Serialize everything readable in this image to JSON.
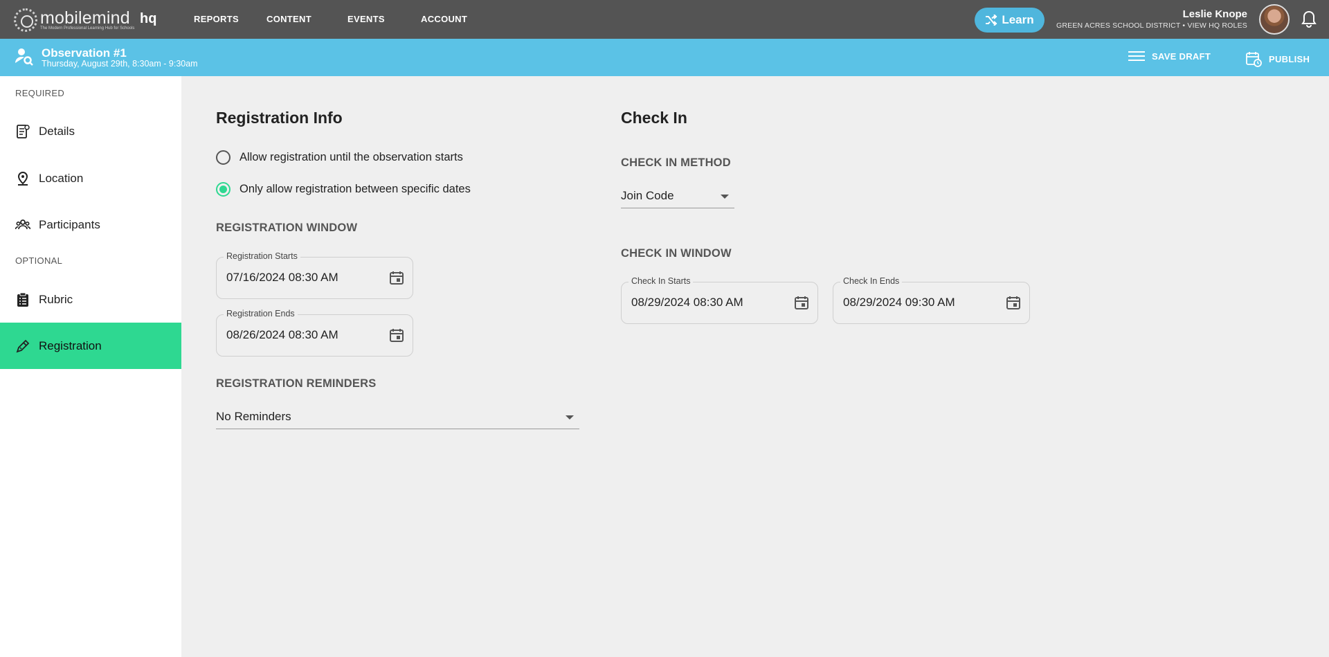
{
  "brand": {
    "logo_word": "mobilemind",
    "tagline": "The Modern Professional Learning Hub for Schools",
    "hq": "hq"
  },
  "nav": {
    "links": [
      "REPORTS",
      "CONTENT",
      "EVENTS",
      "ACCOUNT"
    ],
    "learn_label": "Learn"
  },
  "user": {
    "name": "Leslie Knope",
    "subtitle": "GREEN ACRES SCHOOL DISTRICT • VIEW HQ ROLES"
  },
  "observation": {
    "title": "Observation #1",
    "subtitle": "Thursday, August 29th, 8:30am - 9:30am",
    "save_label": "SAVE DRAFT",
    "publish_label": "PUBLISH"
  },
  "sidebar": {
    "required_label": "REQUIRED",
    "optional_label": "OPTIONAL",
    "items": [
      {
        "label": "Details",
        "icon": "document-icon"
      },
      {
        "label": "Location",
        "icon": "location-pin-icon"
      },
      {
        "label": "Participants",
        "icon": "people-icon"
      },
      {
        "label": "Rubric",
        "icon": "clipboard-icon"
      },
      {
        "label": "Registration",
        "icon": "pen-icon",
        "active": true
      }
    ]
  },
  "registration": {
    "heading": "Registration Info",
    "options": [
      {
        "label": "Allow registration until the observation starts",
        "selected": false
      },
      {
        "label": "Only allow registration between specific dates",
        "selected": true
      }
    ],
    "window_heading": "REGISTRATION WINDOW",
    "starts": {
      "label": "Registration Starts",
      "value": "07/16/2024 08:30 AM"
    },
    "ends": {
      "label": "Registration Ends",
      "value": "08/26/2024 08:30 AM"
    },
    "reminders_heading": "REGISTRATION REMINDERS",
    "reminders_value": "No Reminders"
  },
  "checkin": {
    "heading": "Check In",
    "method_heading": "CHECK IN METHOD",
    "method_value": "Join Code",
    "window_heading": "CHECK IN WINDOW",
    "starts": {
      "label": "Check In Starts",
      "value": "08/29/2024 08:30 AM"
    },
    "ends": {
      "label": "Check In Ends",
      "value": "08/29/2024 09:30 AM"
    }
  },
  "colors": {
    "topnav": "#545454",
    "subbar": "#5bc2e6",
    "accent_green": "#2ed891",
    "learn_button": "#4fb6dd"
  }
}
